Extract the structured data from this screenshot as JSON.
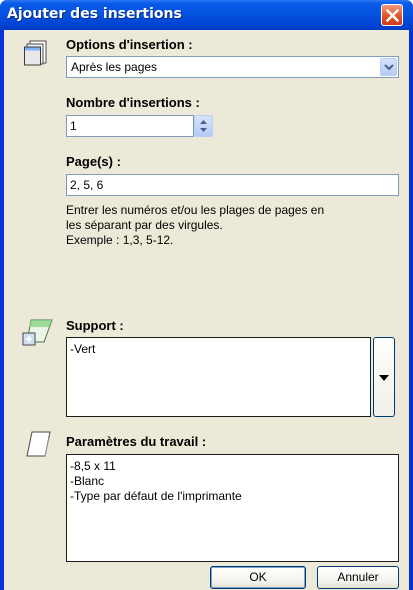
{
  "window": {
    "title": "Ajouter des insertions"
  },
  "options": {
    "label": "Options d'insertion :",
    "selected": "Après les pages"
  },
  "count": {
    "label": "Nombre d'insertions :",
    "value": "1"
  },
  "pages": {
    "label": "Page(s) :",
    "value": "2, 5, 6",
    "help_line1": "Entrer les numéros et/ou les plages de pages en",
    "help_line2": "les séparant par des virgules.",
    "help_line3": "Exemple : 1,3, 5-12."
  },
  "support": {
    "label": "Support :",
    "items": [
      "-Vert"
    ]
  },
  "job": {
    "label": "Paramètres du travail :",
    "items": [
      "-8,5 x 11",
      "-Blanc",
      "-Type par défaut de l'imprimante"
    ]
  },
  "buttons": {
    "ok": "OK",
    "cancel": "Annuler"
  },
  "colors": {
    "titlebar": "#0453e0",
    "face": "#ece9d8",
    "close": "#e0542c"
  },
  "icons": {
    "options": "stacked-pages-icon",
    "support": "media-icon",
    "job": "document-icon",
    "close": "close-icon",
    "dropdown": "chevron-down-icon",
    "spinner": "spinner-arrows-icon"
  }
}
